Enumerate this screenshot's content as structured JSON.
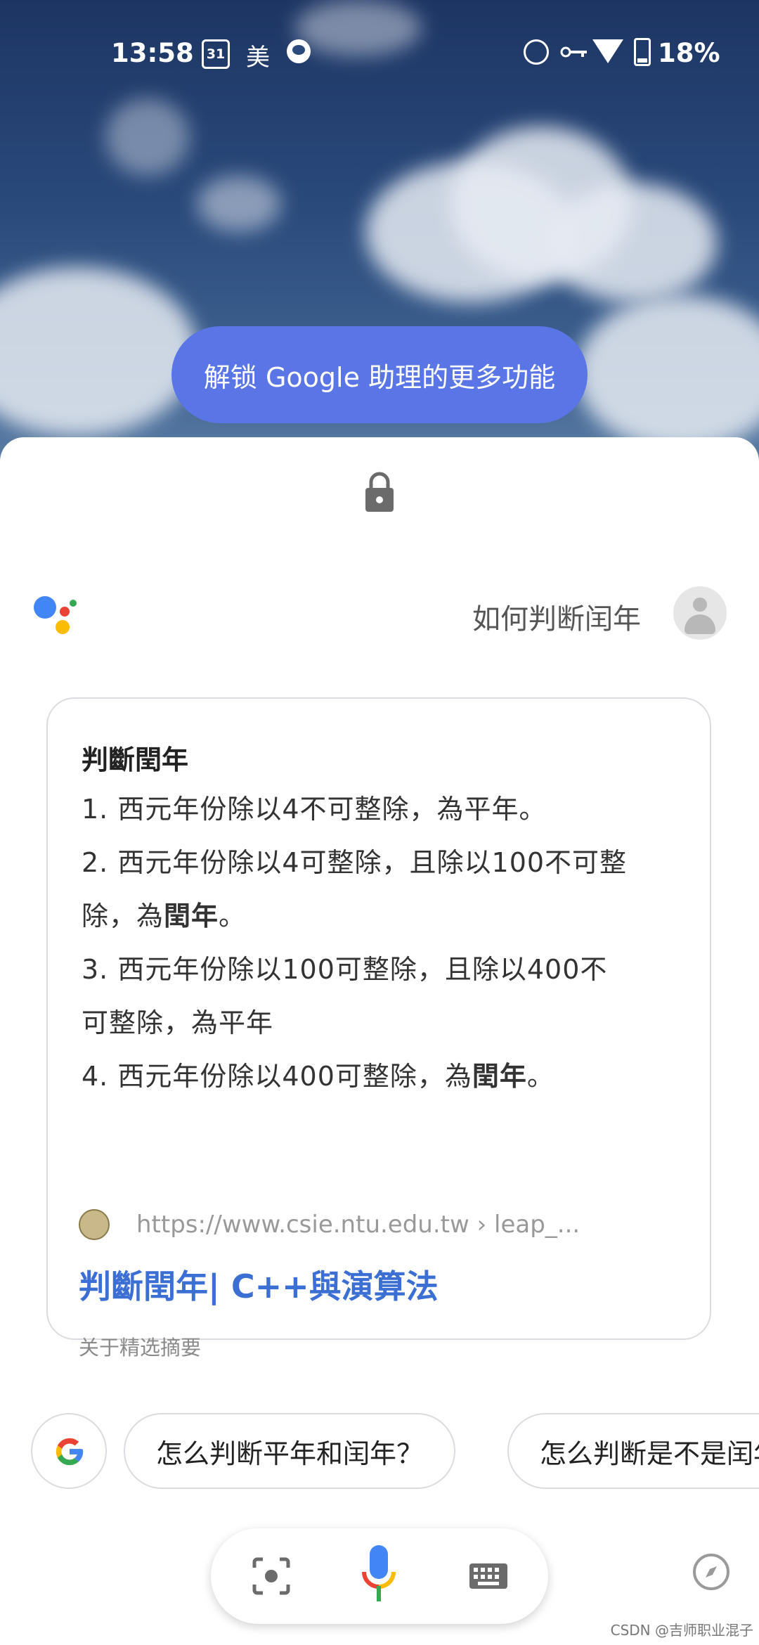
{
  "status_bar": {
    "time": "13:58",
    "calendar_day": "31",
    "app_char": "美",
    "battery": "18%"
  },
  "unlock_button": {
    "label": "解锁 Google 助理的更多功能"
  },
  "conversation": {
    "query": "如何判断闰年"
  },
  "answer_card": {
    "heading": "判斷閏年",
    "lines": [
      {
        "pre": "1. 西元年份除以4不可整除，為平年。",
        "bold": "",
        "post": ""
      },
      {
        "pre": "2. 西元年份除以4可整除，且除以100不可整",
        "bold": "",
        "post": ""
      },
      {
        "pre": "除，為",
        "bold": "閏年",
        "post": "。"
      },
      {
        "pre": "3. 西元年份除以100可整除，且除以400不",
        "bold": "",
        "post": ""
      },
      {
        "pre": "可整除，為平年",
        "bold": "",
        "post": ""
      },
      {
        "pre": "4. 西元年份除以400可整除，為",
        "bold": "閏年",
        "post": "。"
      }
    ],
    "source_url": "https://www.csie.ntu.edu.tw › leap_...",
    "link_title": "判斷閏年| C++與演算法",
    "about_label": "关于精选摘要"
  },
  "suggestions": [
    "怎么判断平年和闰年？",
    "怎么判断是不是闰年"
  ],
  "watermark": "CSDN @吉师职业混子",
  "colors": {
    "accent_blue": "#5a75e6",
    "link_blue": "#3b6fd4",
    "google_blue": "#4285F4",
    "google_red": "#EA4335",
    "google_yellow": "#FBBC05",
    "google_green": "#34A853"
  },
  "icons": [
    "lock-icon",
    "assistant-icon",
    "avatar-icon",
    "google-g-icon",
    "lens-icon",
    "mic-icon",
    "keyboard-icon",
    "compass-icon",
    "alarm-icon",
    "vpn-key-icon",
    "wifi-icon",
    "battery-icon"
  ]
}
